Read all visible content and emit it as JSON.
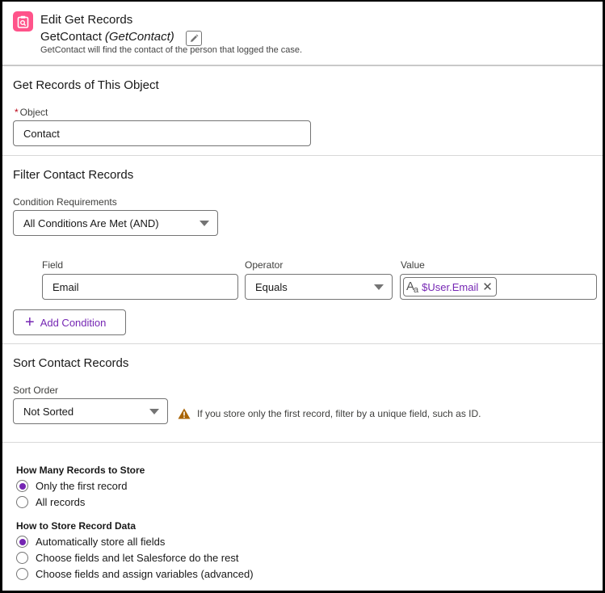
{
  "header": {
    "icon": "get-records-icon",
    "title": "Edit Get Records",
    "label": "GetContact",
    "api_name": "(GetContact)",
    "edit_icon": "pencil-icon",
    "description": "GetContact will find the contact of the person that logged the case."
  },
  "object_section": {
    "title": "Get Records of This Object",
    "object_label": "Object",
    "required_marker": "*",
    "object_value": "Contact"
  },
  "filter_section": {
    "title": "Filter Contact Records",
    "condition_label": "Condition Requirements",
    "condition_value": "All Conditions Are Met (AND)",
    "columns": {
      "field": "Field",
      "operator": "Operator",
      "value": "Value"
    },
    "conditions": [
      {
        "field": "Email",
        "operator": "Equals",
        "value_type_icon": "text-type-icon",
        "value": "$User.Email",
        "remove_icon": "close-icon"
      }
    ],
    "add_condition_label": "Add Condition"
  },
  "sort_section": {
    "title": "Sort Contact Records",
    "sort_label": "Sort Order",
    "sort_value": "Not Sorted",
    "warning_icon": "warning-icon",
    "warning_text": "If you store only the first record, filter by a unique field, such as ID."
  },
  "store_section": {
    "how_many_title": "How Many Records to Store",
    "how_many_options": [
      {
        "label": "Only the first record",
        "selected": true
      },
      {
        "label": "All records",
        "selected": false
      }
    ],
    "how_to_store_title": "How to Store Record Data",
    "how_to_store_options": [
      {
        "label": "Automatically store all fields",
        "selected": true
      },
      {
        "label": "Choose fields and let Salesforce do the rest",
        "selected": false
      },
      {
        "label": "Choose fields and assign variables (advanced)",
        "selected": false
      }
    ]
  },
  "colors": {
    "brand_icon": "#ff538a",
    "accent": "#7526b3",
    "warning": "#a96404",
    "required": "#ba0517"
  }
}
